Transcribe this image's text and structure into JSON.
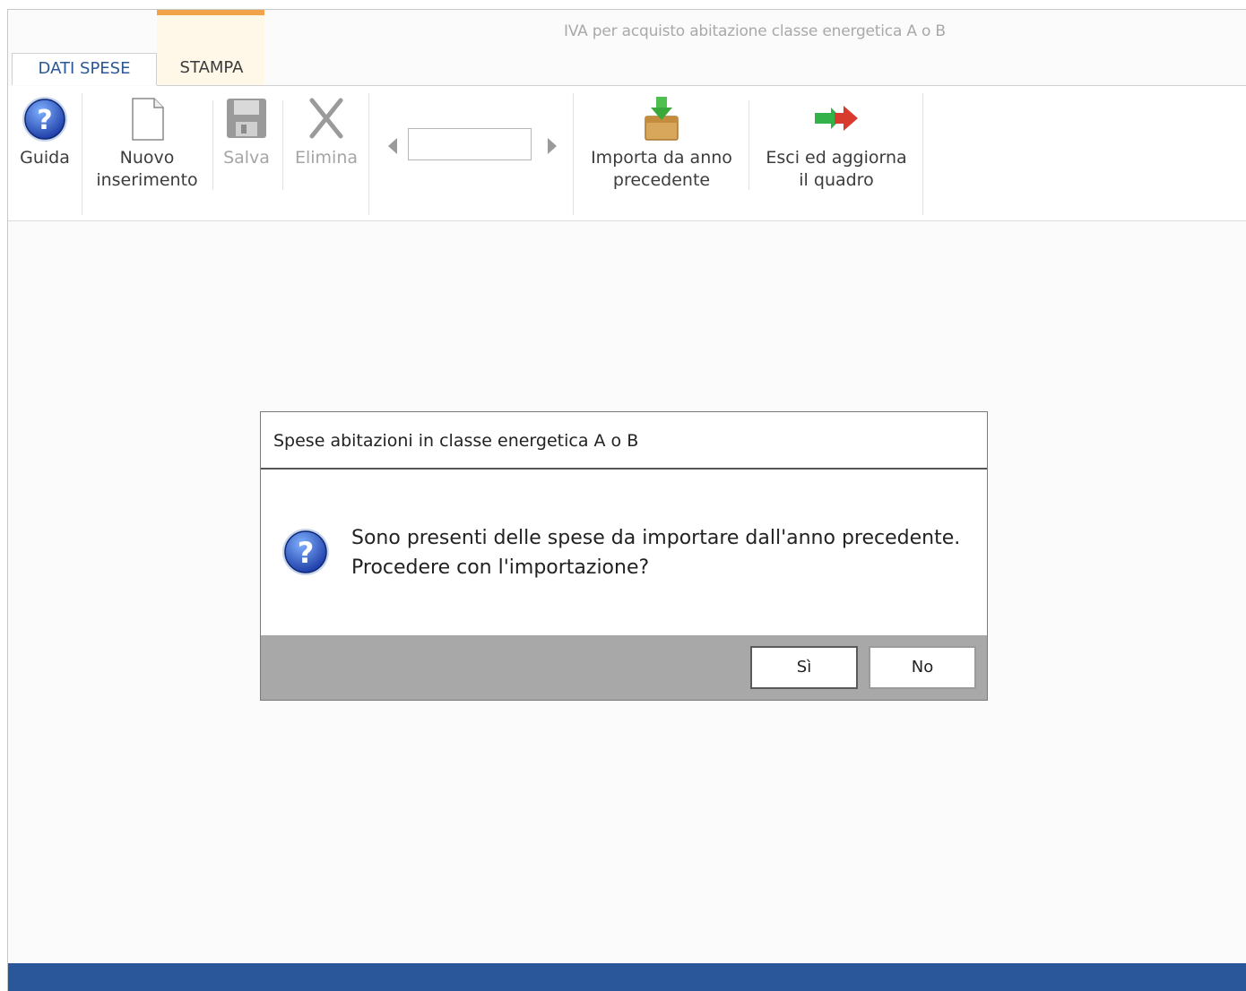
{
  "window": {
    "title": "IVA per acquisto abitazione classe energetica A o B"
  },
  "tabs": [
    {
      "label": "DATI SPESE",
      "active": true
    },
    {
      "label": "STAMPA",
      "active": false
    }
  ],
  "ribbon": {
    "guida": {
      "label": "Guida",
      "icon": "help-icon"
    },
    "nuovo": {
      "label": "Nuovo\ninserimento",
      "icon": "new-document-icon"
    },
    "salva": {
      "label": "Salva",
      "icon": "save-icon",
      "enabled": false
    },
    "elimina": {
      "label": "Elimina",
      "icon": "delete-icon",
      "enabled": false
    },
    "navigator": {
      "value": ""
    },
    "importa": {
      "label": "Importa da anno\nprecedente",
      "icon": "import-box-icon"
    },
    "esci": {
      "label": "Esci ed aggiorna\nil quadro",
      "icon": "exit-arrow-icon"
    }
  },
  "dialog": {
    "title": "Spese abitazioni in classe energetica A o B",
    "message_line1": "Sono presenti delle spese da importare dall'anno precedente.",
    "message_line2": "Procedere con l'importazione?",
    "yes_label": "Sì",
    "no_label": "No",
    "icon": "question-icon"
  },
  "colors": {
    "accent_blue": "#2a579a",
    "tab_highlight": "#f2a34a",
    "dialog_footer": "#a8a8a8"
  }
}
